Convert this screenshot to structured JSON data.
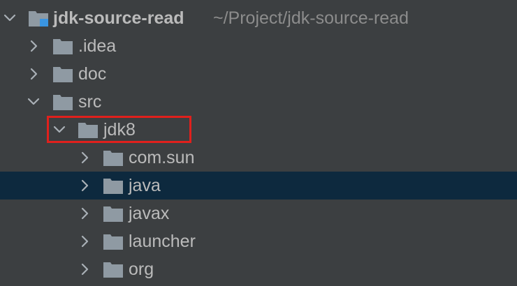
{
  "project_tree": {
    "root": {
      "name": "jdk-source-read",
      "path": "~/Project/jdk-source-read",
      "expanded": true,
      "icon": "module-folder-icon"
    },
    "items": [
      {
        "label": ".idea",
        "expanded": false,
        "selected": false,
        "icon": "folder-icon"
      },
      {
        "label": "doc",
        "expanded": false,
        "selected": false,
        "icon": "folder-icon"
      },
      {
        "label": "src",
        "expanded": true,
        "selected": false,
        "icon": "folder-icon"
      },
      {
        "label": "jdk8",
        "expanded": true,
        "selected": false,
        "highlighted": true,
        "icon": "folder-icon"
      },
      {
        "label": "com.sun",
        "expanded": false,
        "selected": false,
        "icon": "folder-icon"
      },
      {
        "label": "java",
        "expanded": false,
        "selected": true,
        "icon": "folder-icon"
      },
      {
        "label": "javax",
        "expanded": false,
        "selected": false,
        "icon": "folder-icon"
      },
      {
        "label": "launcher",
        "expanded": false,
        "selected": false,
        "icon": "folder-icon"
      },
      {
        "label": "org",
        "expanded": false,
        "selected": false,
        "icon": "folder-icon"
      }
    ]
  },
  "colors": {
    "background": "#3c3f41",
    "selection": "#0d293e",
    "text": "#bbbbbb",
    "path_text": "#8c8c8c",
    "folder": "#8f9aa3",
    "highlight_border": "#e0201c",
    "module_marker": "#3a95e1"
  }
}
